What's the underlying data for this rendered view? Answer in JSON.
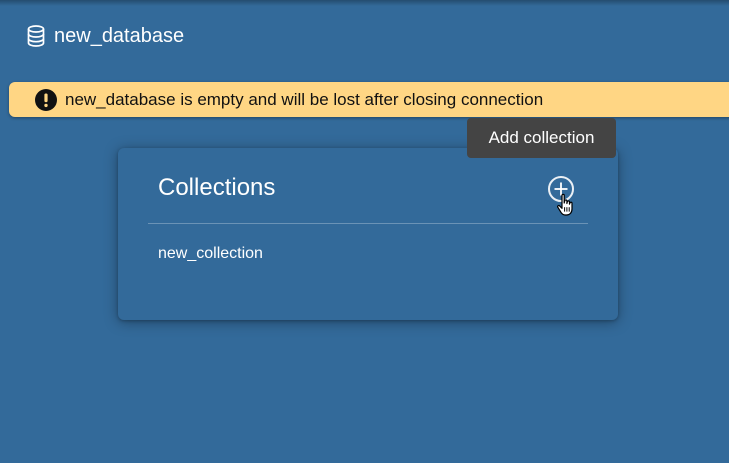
{
  "header": {
    "database_name": "new_database",
    "icon": "database-icon"
  },
  "warning": {
    "icon": "exclamation-icon",
    "message": "new_database is empty and will be lost after closing connection",
    "background_color": "#ffd684"
  },
  "collections_panel": {
    "title": "Collections",
    "add_icon": "plus-circle-icon",
    "tooltip": "Add collection",
    "items": [
      {
        "label": "new_collection"
      }
    ]
  },
  "colors": {
    "background": "#336a9a",
    "tooltip_background": "#444444"
  }
}
